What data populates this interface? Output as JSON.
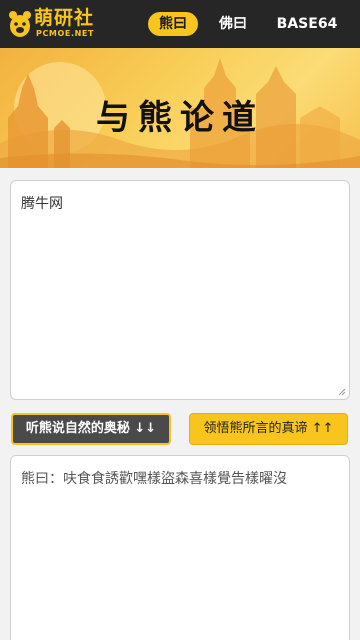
{
  "header": {
    "logo_title": "萌研社",
    "logo_subtitle": "PCMOE.NET",
    "nav": [
      {
        "label": "熊曰",
        "active": true
      },
      {
        "label": "佛曰",
        "active": false
      },
      {
        "label": "BASE64",
        "active": false
      }
    ]
  },
  "banner": {
    "title": "与熊论道"
  },
  "input": {
    "value": "腾牛网"
  },
  "buttons": {
    "decode_label": "听熊说自然的奥秘 ↓↓",
    "encode_label": "领悟熊所言的真谛 ↑↑"
  },
  "output": {
    "value": "熊曰：呋食食誘歡嘿樣盜森喜樣覺告樣曜沒"
  },
  "colors": {
    "accent": "#f7c51e",
    "header_bg": "#262626",
    "button_dark": "#4a4a4a"
  }
}
